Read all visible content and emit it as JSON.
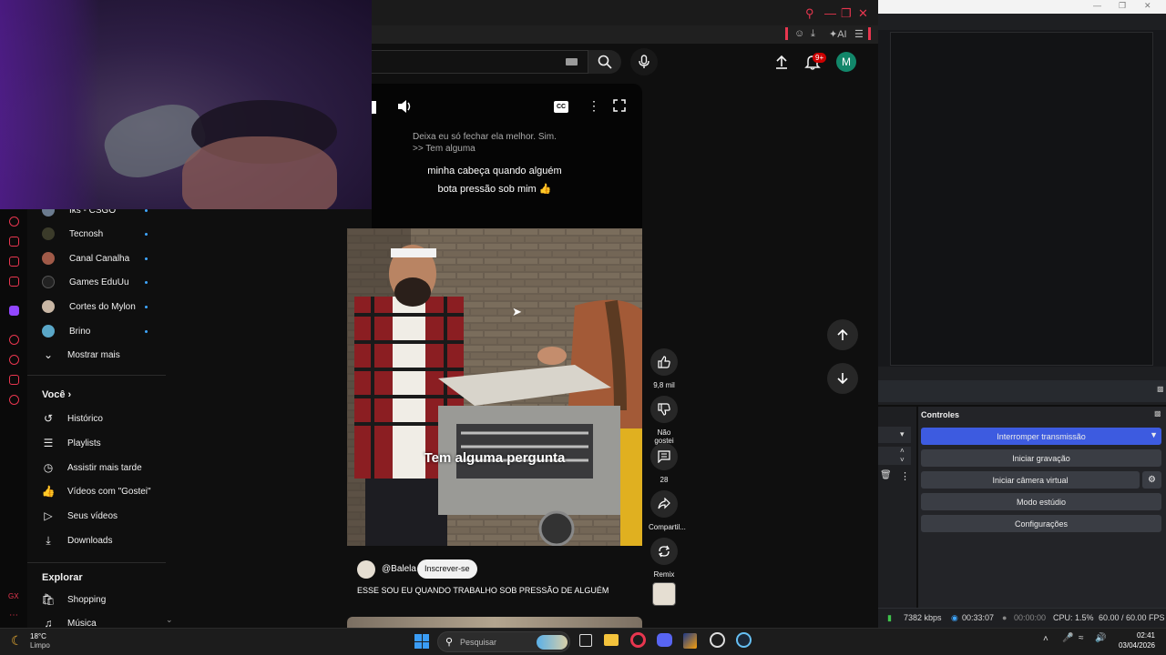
{
  "header": {
    "notification_count": "9+",
    "avatar_letter": "M"
  },
  "sidebar": {
    "subscriptions": [
      {
        "name": "Iks - CSGO",
        "avatar": "#6b7b8f"
      },
      {
        "name": "Tecnosh",
        "avatar": "#3b3b2a"
      },
      {
        "name": "Canal Canalha",
        "avatar": "#a05a48"
      },
      {
        "name": "Games EduUu",
        "avatar": "#222222"
      },
      {
        "name": "Cortes do Mylon",
        "avatar": "#c9b7a5"
      },
      {
        "name": "Brino",
        "avatar": "#5aa7c8"
      }
    ],
    "show_more": "Mostrar mais",
    "you_heading": "Você",
    "you_items": [
      "Histórico",
      "Playlists",
      "Assistir mais tarde",
      "Vídeos com \"Gostei\"",
      "Seus vídeos",
      "Downloads"
    ],
    "explore_heading": "Explorar",
    "explore_items": [
      "Shopping",
      "Música"
    ]
  },
  "short": {
    "caption_text": "Deixa eu só fechar ela melhor. Sim.",
    "caption_text2": ">> Tem alguma",
    "overlay_line1": "minha cabeça quando alguém",
    "overlay_line2": "bota pressão sob mim 👍",
    "video_subtitle": "Tem alguma pergunta",
    "channel": "@Balela",
    "subscribe": "Inscrever-se",
    "title": "ESSE SOU EU QUANDO TRABALHO SOB PRESSÃO DE ALGUÉM",
    "likes": "9,8 mil",
    "dislike": "Não gostei",
    "comments": "28",
    "share": "Compartil...",
    "remix": "Remix"
  },
  "obs": {
    "controls_title": "Controles",
    "buttons": [
      "Interromper transmissão",
      "Iniciar gravação",
      "Iniciar câmera virtual",
      "Modo estúdio",
      "Configurações"
    ],
    "status": {
      "bitrate": "7382 kbps",
      "stream_time": "00:33:07",
      "rec_time": "00:00:00",
      "cpu": "CPU: 1.5%",
      "fps": "60.00 / 60.00 FPS"
    }
  },
  "taskbar": {
    "weather_temp": "18°C",
    "weather_desc": "Limpo",
    "search_placeholder": "Pesquisar",
    "time": "02:41",
    "date": "03/04/2026"
  },
  "colors": {
    "accent_red": "#e8364f",
    "obs_primary": "#3d5be0",
    "yt_bg": "#0f0f0f"
  }
}
